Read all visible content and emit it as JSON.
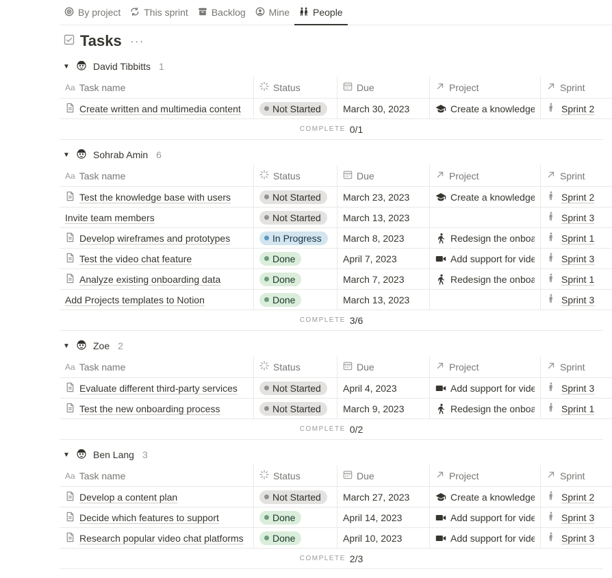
{
  "tabs": [
    {
      "label": "By project",
      "icon": "target-icon",
      "active": false
    },
    {
      "label": "This sprint",
      "icon": "repeat-icon",
      "active": false
    },
    {
      "label": "Backlog",
      "icon": "archive-icon",
      "active": false
    },
    {
      "label": "Mine",
      "icon": "user-circle-icon",
      "active": false
    },
    {
      "label": "People",
      "icon": "people-icon",
      "active": true
    }
  ],
  "page": {
    "title": "Tasks",
    "more": "···"
  },
  "columns": {
    "name": "Task name",
    "name_prefix": "Aa",
    "status": "Status",
    "due": "Due",
    "project": "Project",
    "sprint": "Sprint"
  },
  "complete_label": "COMPLETE",
  "groups": [
    {
      "person": "David Tibbitts",
      "count": "1",
      "complete": "0/1",
      "rows": [
        {
          "name": "Create written and multimedia content",
          "doc": true,
          "status": "Not Started",
          "status_kind": "ns",
          "due": "March 30, 2023",
          "project": "Create a knowledge base",
          "project_icon": "graduation-cap-icon",
          "sprint": "Sprint 2"
        }
      ]
    },
    {
      "person": "Sohrab Amin",
      "count": "6",
      "complete": "3/6",
      "rows": [
        {
          "name": "Test the knowledge base with users",
          "doc": true,
          "status": "Not Started",
          "status_kind": "ns",
          "due": "March 23, 2023",
          "project": "Create a knowledge base",
          "project_icon": "graduation-cap-icon",
          "sprint": "Sprint 2"
        },
        {
          "name": "Invite team members",
          "doc": false,
          "status": "Not Started",
          "status_kind": "ns",
          "due": "March 13, 2023",
          "project": "",
          "project_icon": "",
          "sprint": "Sprint 3"
        },
        {
          "name": "Develop wireframes and prototypes",
          "doc": true,
          "status": "In Progress",
          "status_kind": "ip",
          "due": "March 8, 2023",
          "project": "Redesign the onboarding",
          "project_icon": "walking-person-icon",
          "sprint": "Sprint 1"
        },
        {
          "name": "Test the video chat feature",
          "doc": true,
          "status": "Done",
          "status_kind": "dn",
          "due": "April 7, 2023",
          "project": "Add support for video chat",
          "project_icon": "video-camera-icon",
          "sprint": "Sprint 3"
        },
        {
          "name": "Analyze existing onboarding data",
          "doc": true,
          "status": "Done",
          "status_kind": "dn",
          "due": "March 7, 2023",
          "project": "Redesign the onboarding",
          "project_icon": "walking-person-icon",
          "sprint": "Sprint 1"
        },
        {
          "name": "Add Projects templates to Notion",
          "doc": false,
          "status": "Done",
          "status_kind": "dn",
          "due": "March 13, 2023",
          "project": "",
          "project_icon": "",
          "sprint": "Sprint 3"
        }
      ]
    },
    {
      "person": "Zoe",
      "count": "2",
      "complete": "0/2",
      "rows": [
        {
          "name": "Evaluate different third-party services",
          "doc": true,
          "status": "Not Started",
          "status_kind": "ns",
          "due": "April 4, 2023",
          "project": "Add support for video chat",
          "project_icon": "video-camera-icon",
          "sprint": "Sprint 3"
        },
        {
          "name": "Test the new onboarding process",
          "doc": true,
          "status": "Not Started",
          "status_kind": "ns",
          "due": "March 9, 2023",
          "project": "Redesign the onboarding",
          "project_icon": "walking-person-icon",
          "sprint": "Sprint 1"
        }
      ]
    },
    {
      "person": "Ben Lang",
      "count": "3",
      "complete": "2/3",
      "rows": [
        {
          "name": "Develop a content plan",
          "doc": true,
          "status": "Not Started",
          "status_kind": "ns",
          "due": "March 27, 2023",
          "project": "Create a knowledge base",
          "project_icon": "graduation-cap-icon",
          "sprint": "Sprint 2"
        },
        {
          "name": "Decide which features to support",
          "doc": true,
          "status": "Done",
          "status_kind": "dn",
          "due": "April 14, 2023",
          "project": "Add support for video chat",
          "project_icon": "video-camera-icon",
          "sprint": "Sprint 3"
        },
        {
          "name": "Research popular video chat platforms",
          "doc": true,
          "status": "Done",
          "status_kind": "dn",
          "due": "April 10, 2023",
          "project": "Add support for video chat",
          "project_icon": "video-camera-icon",
          "sprint": "Sprint 3"
        }
      ]
    }
  ]
}
